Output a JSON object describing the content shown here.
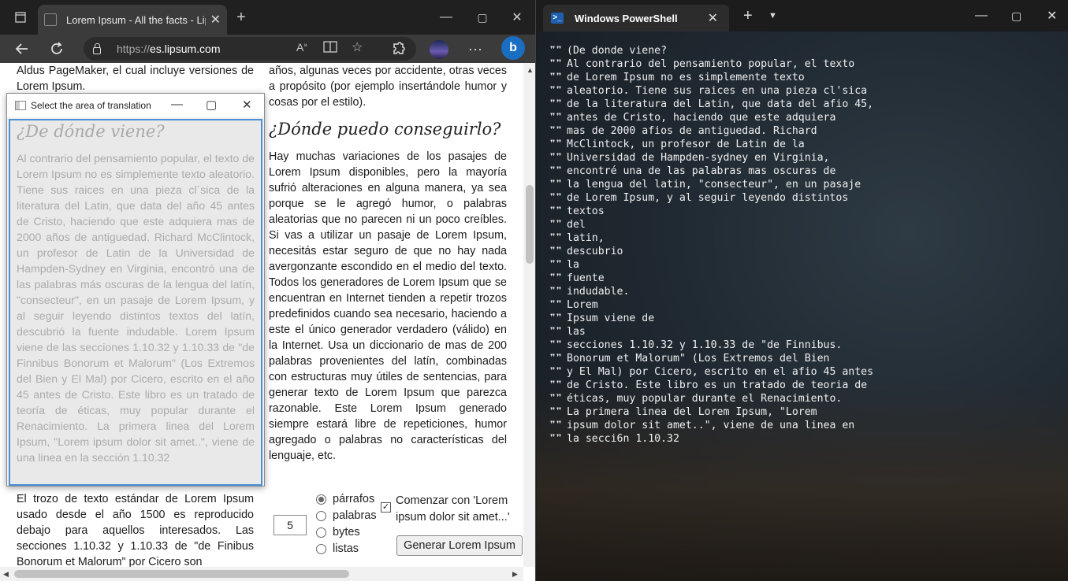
{
  "browser": {
    "tab_title": "Lorem Ipsum - All the facts - Lips",
    "tab_close": "✕",
    "new_tab": "+",
    "url_prefix": "https://",
    "url_host": "es.lipsum.com",
    "window_controls": [
      "—",
      "▢",
      "✕"
    ]
  },
  "page": {
    "top_left_para": "Aldus PageMaker, el cual incluye versiones de Lorem Ipsum.",
    "top_right_para": "años, algunas veces por accidente, otras veces a propósito (por ejemplo insertándole humor y cosas por el estilo).",
    "right_heading": "¿Dónde puedo conseguirlo?",
    "right_para": "Hay muchas variaciones de los pasajes de Lorem Ipsum disponibles, pero la mayoría sufrió alteraciones en alguna manera, ya sea porque se le agregó humor, o palabras aleatorias que no parecen ni un poco creíbles. Si vas a utilizar un pasaje de Lorem Ipsum, necesitás estar seguro de que no hay nada avergonzante escondido en el medio del texto. Todos los generadores de Lorem Ipsum que se encuentran en Internet tienden a repetir trozos predefinidos cuando sea necesario, haciendo a este el único generador verdadero (válido) en la Internet. Usa un diccionario de mas de 200 palabras provenientes del latín, combinadas con estructuras muy útiles de sentencias, para generar texto de Lorem Ipsum que parezca razonable. Este Lorem Ipsum generado siempre estará libre de repeticiones, humor agregado o palabras no características del lenguaje, etc.",
    "bottom_left_para": "El trozo de texto estándar de Lorem Ipsum usado desde el año 1500 es reproducido debajo para aquellos interesados. Las secciones 1.10.32 y 1.10.33 de \"de Finibus Bonorum et Malorum\" por Cicero son",
    "form": {
      "count_value": "5",
      "radio_options": [
        "párrafos",
        "palabras",
        "bytes",
        "listas"
      ],
      "selected_option": "párrafos",
      "checkbox_checked": true,
      "checkbox_label": "Comenzar con 'Lorem ipsum dolor sit amet...'",
      "generate_button": "Generar Lorem Ipsum"
    }
  },
  "overlay": {
    "title": "Select the area of translation",
    "heading": "¿De dónde viene?",
    "para": "Al contrario del pensamiento popular, el texto de Lorem Ipsum no es simplemente texto aleatorio. Tiene sus raices en una pieza cl´sica de la literatura del Latin, que data del año 45 antes de Cristo, haciendo que este adquiera mas de 2000 años de antiguedad. Richard McClintock, un profesor de Latin de la Universidad de Hampden-Sydney en Virginia, encontró una de las palabras más oscuras de la lengua del latín, \"consecteur\", en un pasaje de Lorem Ipsum, y al seguir leyendo distintos textos del latín, descubrió la fuente indudable. Lorem Ipsum viene de las secciones 1.10.32 y 1.10.33 de \"de Finnibus Bonorum et Malorum\" (Los Extremos del Bien y El Mal) por Cicero, escrito en el año 45 antes de Cristo. Este libro es un tratado de teoría de éticas, muy popular durante el Renacimiento. La primera linea del Lorem Ipsum, \"Lorem ipsum dolor sit amet..\", viene de una linea en la sección 1.10.32"
  },
  "powershell": {
    "tab_title": "Windows PowerShell",
    "prefix": "❞❞",
    "lines": [
      "(De donde viene?",
      "Al contrario del pensamiento popular, el texto",
      "de Lorem Ipsum no es simplemente texto",
      "aleatorio. Tiene sus raices en una pieza cl'sica",
      "de la literatura del Latin, que data del afio 45,",
      "antes de Cristo, haciendo que este adquiera",
      "mas de 2000 afios de antiguedad. Richard",
      "McClintock, un profesor de Latin de la",
      "Universidad de Hampden-sydney en Virginia,",
      "encontré una de las palabras mas oscuras de",
      "la lengua del latin, \"consecteur\", en un pasaje",
      "de Lorem Ipsum, y al seguir leyendo distintos",
      "textos",
      "del",
      "latin,",
      "descubrio",
      "la",
      "fuente",
      "indudable.",
      "Lorem",
      "Ipsum viene de",
      "las",
      "secciones 1.10.32 y 1.10.33 de \"de Finnibus.",
      "Bonorum et Malorum\" (Los Extremos del Bien",
      "y El Mal) por Cicero, escrito en el afio 45 antes",
      "de Cristo. Este libro es un tratado de teoria de",
      "éticas, muy popular durante el Renacimiento.",
      "La primera linea del Lorem Ipsum, \"Lorem",
      "ipsum dolor sit amet..\", viene de una linea en",
      "la secci6n 1.10.32"
    ]
  }
}
